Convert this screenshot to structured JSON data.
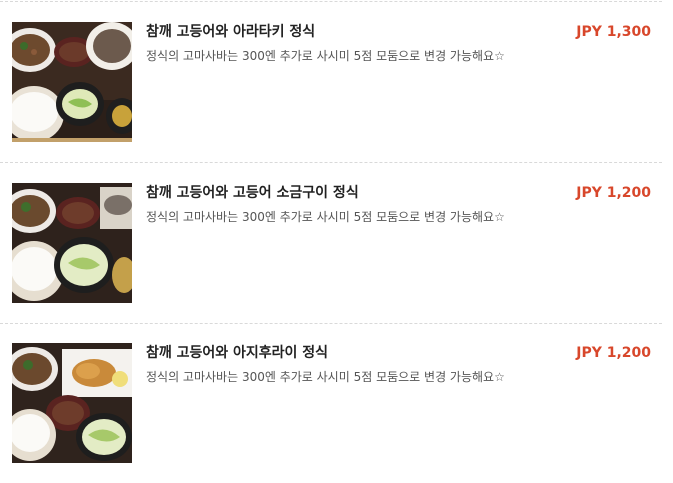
{
  "menu": {
    "items": [
      {
        "name": "참깨 고등어와 아라타키 정식",
        "description": "정식의 고마사바는 300엔 추가로 사시미 5점 모둠으로 변경 가능해요☆",
        "price": "JPY 1,300",
        "photo": "set-meal-photo"
      },
      {
        "name": "참깨 고등어와 고등어 소금구이 정식",
        "description": "정식의 고마사바는 300엔 추가로 사시미 5점 모둠으로 변경 가능해요☆",
        "price": "JPY 1,200",
        "photo": "set-meal-photo"
      },
      {
        "name": "참깨 고등어와 아지후라이 정식",
        "description": "정식의 고마사바는 300엔 추가로 사시미 5점 모둠으로 변경 가능해요☆",
        "price": "JPY 1,200",
        "photo": "set-meal-photo"
      }
    ]
  },
  "colors": {
    "price": "#d8472b",
    "name": "#222222",
    "description": "#555555",
    "divider": "#d9d9d9"
  }
}
